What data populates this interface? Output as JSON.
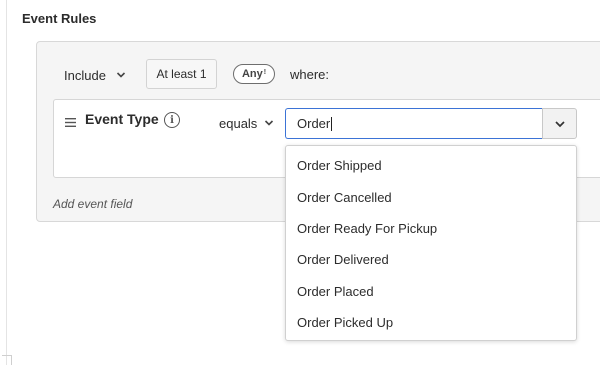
{
  "page": {
    "title": "Event Rules"
  },
  "rule_header": {
    "include_label": "Include",
    "count_button": "At least 1",
    "any_label": "Any",
    "any_sup": "!",
    "where_label": "where:"
  },
  "rule": {
    "field_label": "Event Type",
    "operator": "equals",
    "input_value": "Order",
    "add_field_label": "Add event field"
  },
  "dropdown": {
    "options": [
      "Order Shipped",
      "Order Cancelled",
      "Order Ready For Pickup",
      "Order Delivered",
      "Order Placed",
      "Order Picked Up"
    ]
  },
  "colors": {
    "focus_border": "#3b73d6",
    "panel_bg": "#f5f5f5"
  },
  "icons": {
    "drag": "drag-handle-icon",
    "info": "info-icon",
    "chevron": "chevron-down-icon"
  }
}
